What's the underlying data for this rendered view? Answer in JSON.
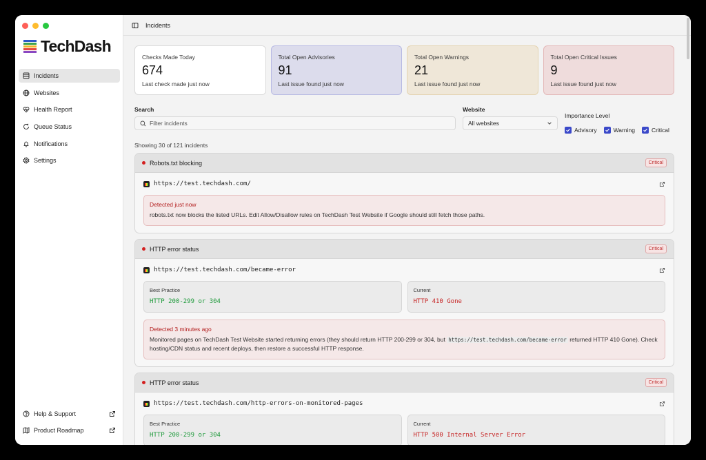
{
  "app": {
    "name": "TechDash",
    "page_title": "Incidents",
    "brand_colors": [
      "#2f58c9",
      "#3fa34d",
      "#f2b52b",
      "#e5473f",
      "#8a48c2"
    ]
  },
  "sidebar": {
    "items": [
      {
        "label": "Incidents",
        "icon": "list-icon"
      },
      {
        "label": "Websites",
        "icon": "globe-icon"
      },
      {
        "label": "Health Report",
        "icon": "heart-pulse-icon"
      },
      {
        "label": "Queue Status",
        "icon": "refresh-icon"
      },
      {
        "label": "Notifications",
        "icon": "bell-icon"
      },
      {
        "label": "Settings",
        "icon": "gear-icon"
      }
    ],
    "bottom": [
      {
        "label": "Help & Support",
        "icon": "help-icon"
      },
      {
        "label": "Product Roadmap",
        "icon": "map-icon"
      }
    ]
  },
  "stats": [
    {
      "label": "Checks Made Today",
      "value": "674",
      "sub": "Last check made just now"
    },
    {
      "label": "Total Open Advisories",
      "value": "91",
      "sub": "Last issue found just now"
    },
    {
      "label": "Total Open Warnings",
      "value": "21",
      "sub": "Last issue found just now"
    },
    {
      "label": "Total Open Critical Issues",
      "value": "9",
      "sub": "Last issue found just now"
    }
  ],
  "filters": {
    "search_label": "Search",
    "search_placeholder": "Filter incidents",
    "website_label": "Website",
    "website_value": "All websites",
    "importance_label": "Importance Level",
    "levels": [
      "Advisory",
      "Warning",
      "Critical"
    ]
  },
  "showing": "Showing 30 of 121 incidents",
  "incidents": [
    {
      "title": "Robots.txt blocking",
      "badge": "Critical",
      "url": "https://test.techdash.com/",
      "alert_title": "Detected just now",
      "alert_text": "robots.txt now blocks the listed URLs. Edit Allow/Disallow rules on TechDash Test Website if Google should still fetch those paths."
    },
    {
      "title": "HTTP error status",
      "badge": "Critical",
      "url": "https://test.techdash.com/became-error",
      "best_label": "Best Practice",
      "best_value": "HTTP 200-299 or 304",
      "current_label": "Current",
      "current_value": "HTTP 410 Gone",
      "alert_title": "Detected 3 minutes ago",
      "alert_text_1": "Monitored pages on TechDash Test Website started returning errors (they should return HTTP 200-299 or 304, but",
      "alert_code": "https://test.techdash.com/became-error",
      "alert_text_2": "returned HTTP 410 Gone). Check hosting/CDN status and recent deploys, then restore a successful HTTP response."
    },
    {
      "title": "HTTP error status",
      "badge": "Critical",
      "url": "https://test.techdash.com/http-errors-on-monitored-pages",
      "best_label": "Best Practice",
      "best_value": "HTTP 200-299 or 304",
      "current_label": "Current",
      "current_value": "HTTP 500 Internal Server Error"
    }
  ]
}
